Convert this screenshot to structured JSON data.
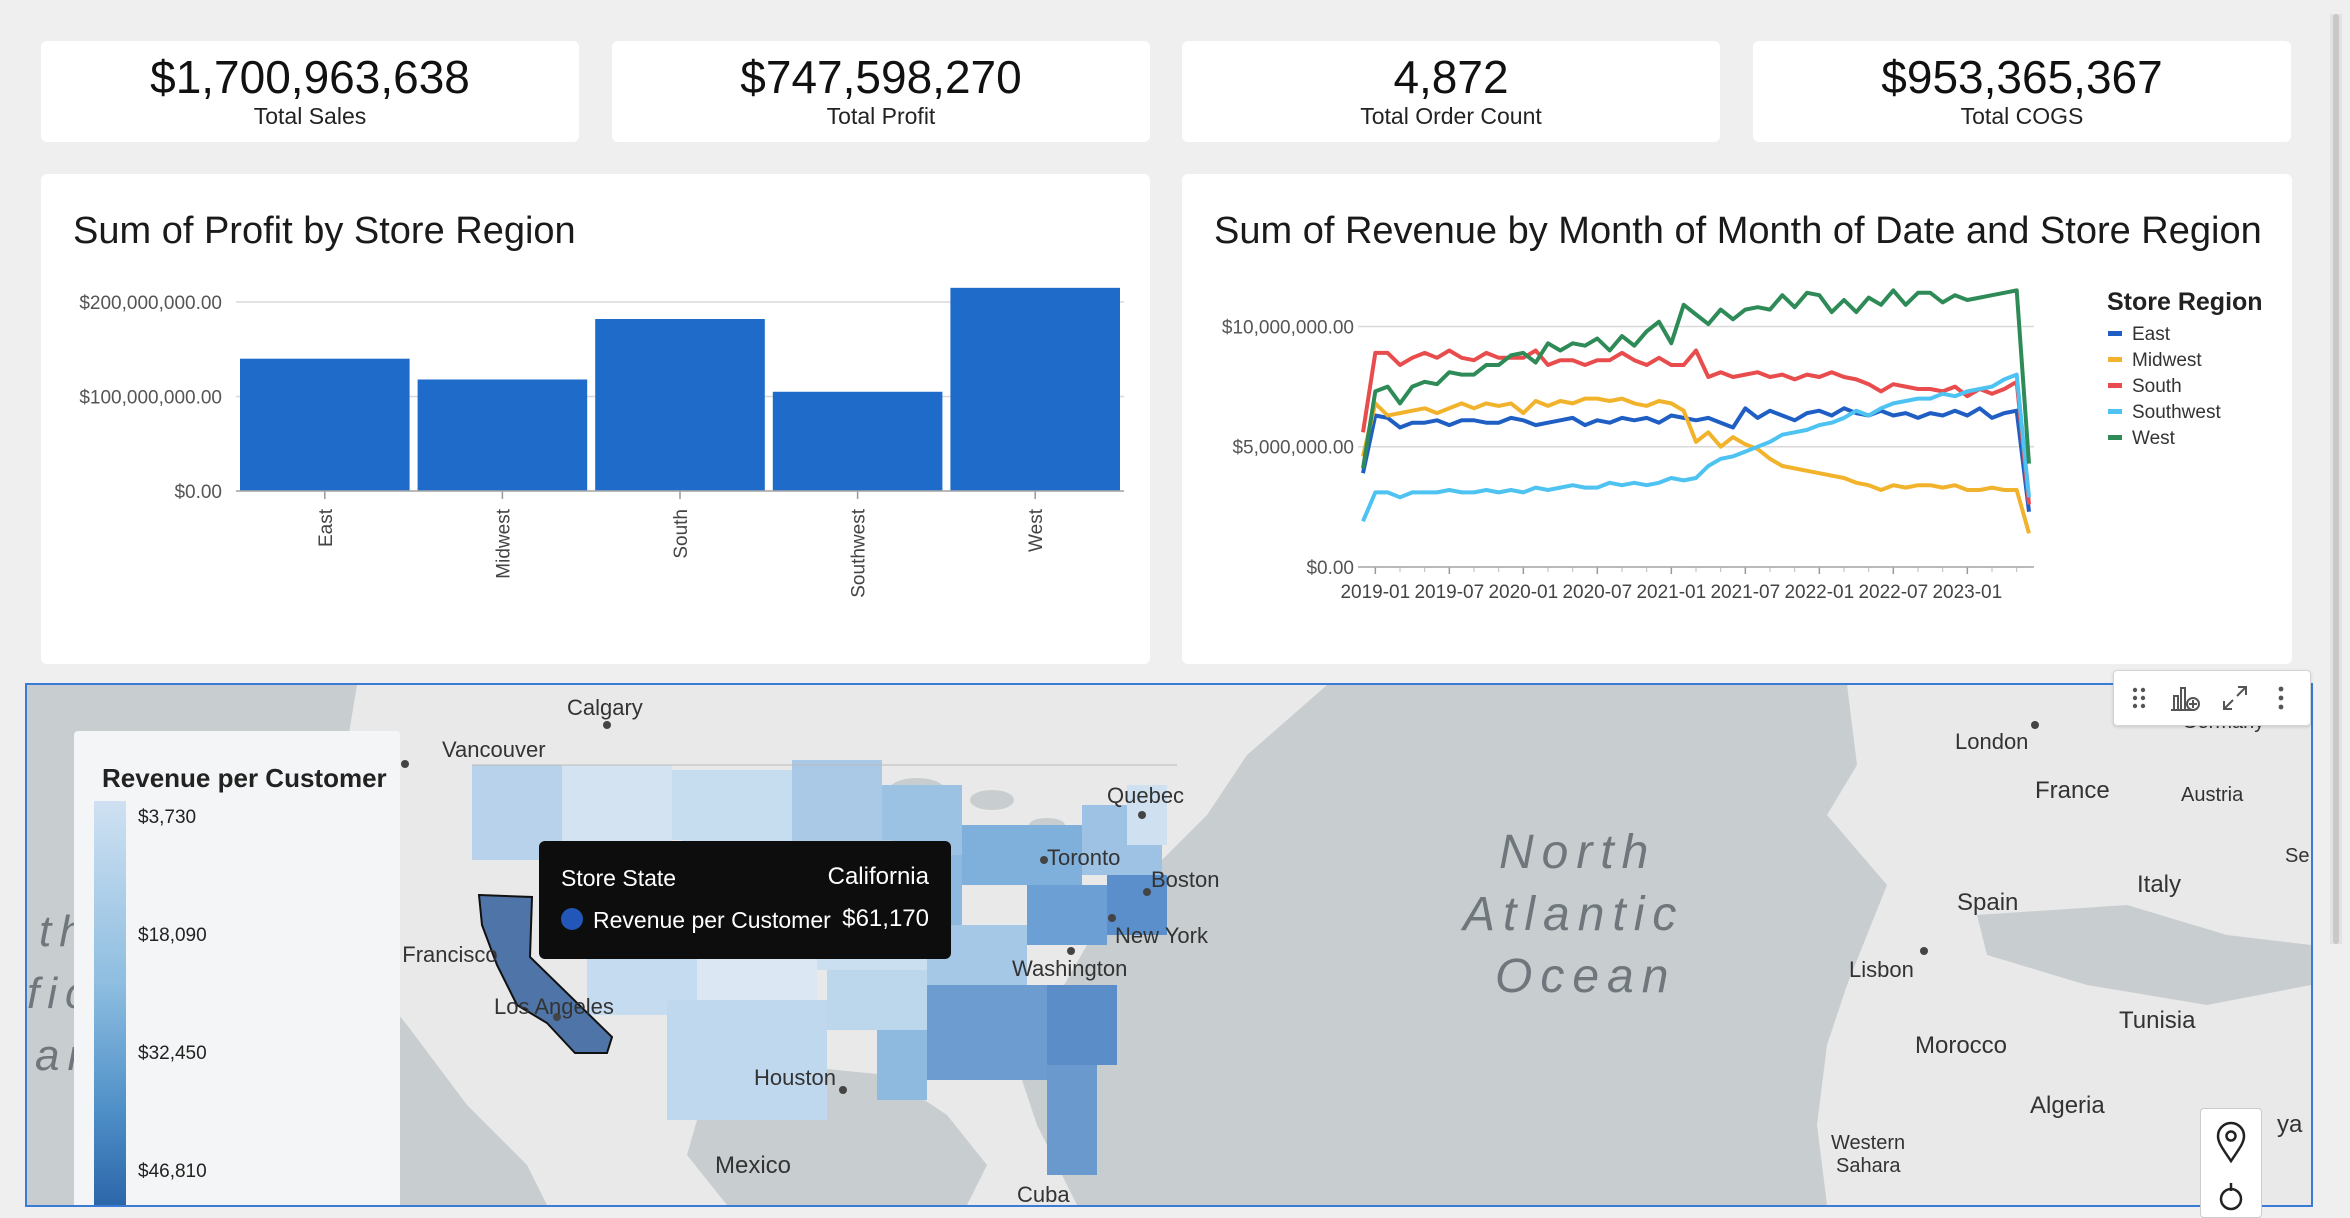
{
  "kpis": [
    {
      "value": "$1,700,963,638",
      "label": "Total Sales"
    },
    {
      "value": "$747,598,270",
      "label": "Total Profit"
    },
    {
      "value": "4,872",
      "label": "Total Order Count"
    },
    {
      "value": "$953,365,367",
      "label": "Total COGS"
    }
  ],
  "bar_card": {
    "title": "Sum of Profit by Store Region"
  },
  "line_card": {
    "title": "Sum of Revenue by Month of Month of Date and Store Region"
  },
  "chart_data": [
    {
      "type": "bar",
      "title": "Sum of Profit by Store Region",
      "categories": [
        "East",
        "Midwest",
        "South",
        "Southwest",
        "West"
      ],
      "values": [
        140000000,
        118000000,
        182000000,
        105000000,
        215000000
      ],
      "yticks": [
        "$0.00",
        "$100,000,000.00",
        "$200,000,000.00"
      ],
      "ylim": [
        0,
        215000000
      ],
      "color": "#1f6bc9",
      "grid": true
    },
    {
      "type": "line",
      "title": "Sum of Revenue by Month of Month of Date and Store Region",
      "legend_title": "Store Region",
      "legend_position": "right",
      "x_start": "2018-12",
      "xticks": [
        "2019-01",
        "2019-07",
        "2020-01",
        "2020-07",
        "2021-01",
        "2021-07",
        "2022-01",
        "2022-07",
        "2023-01"
      ],
      "yticks": [
        "$0.00",
        "$5,000,000.00",
        "$10,000,000.00"
      ],
      "ylim": [
        0,
        11600000
      ],
      "series": [
        {
          "name": "East",
          "color": "#1f5fc4",
          "values": [
            3.9,
            6.3,
            6.2,
            5.8,
            6.0,
            6.0,
            6.1,
            5.9,
            6.1,
            6.1,
            6.0,
            6.0,
            6.2,
            6.1,
            5.9,
            6.0,
            6.1,
            6.2,
            5.9,
            6.1,
            6.0,
            6.2,
            6.1,
            6.2,
            6.0,
            6.3,
            6.2,
            6.1,
            6.2,
            6.0,
            5.8,
            6.6,
            6.2,
            6.5,
            6.3,
            6.1,
            6.4,
            6.5,
            6.3,
            6.6,
            6.4,
            6.3,
            6.5,
            6.3,
            6.4,
            6.2,
            6.4,
            6.3,
            6.5,
            6.3,
            6.6,
            6.2,
            6.4,
            6.5,
            2.3
          ]
        },
        {
          "name": "Midwest",
          "color": "#f2b32c",
          "values": [
            4.6,
            6.8,
            6.3,
            6.4,
            6.5,
            6.6,
            6.4,
            6.6,
            6.8,
            6.6,
            6.8,
            6.7,
            6.8,
            6.4,
            6.9,
            6.7,
            6.9,
            6.8,
            7.0,
            7.0,
            6.9,
            7.0,
            6.8,
            6.7,
            6.9,
            6.8,
            6.5,
            5.2,
            5.6,
            5.0,
            5.4,
            5.1,
            4.9,
            4.5,
            4.2,
            4.1,
            4.0,
            3.9,
            3.8,
            3.7,
            3.5,
            3.4,
            3.2,
            3.4,
            3.3,
            3.4,
            3.4,
            3.3,
            3.4,
            3.2,
            3.2,
            3.3,
            3.2,
            3.2,
            1.4
          ]
        },
        {
          "name": "South",
          "color": "#e84c4c",
          "values": [
            5.6,
            8.9,
            8.9,
            8.4,
            8.7,
            8.9,
            8.7,
            9.0,
            8.7,
            8.6,
            8.9,
            8.7,
            8.7,
            8.7,
            9.0,
            8.4,
            8.6,
            8.6,
            8.4,
            8.6,
            8.6,
            8.9,
            8.6,
            8.4,
            8.7,
            8.4,
            8.4,
            9.0,
            7.9,
            8.1,
            7.9,
            8.0,
            8.1,
            7.9,
            8.0,
            7.8,
            8.0,
            7.9,
            8.1,
            7.9,
            7.8,
            7.6,
            7.3,
            7.6,
            7.5,
            7.4,
            7.4,
            7.3,
            7.5,
            7.1,
            7.4,
            7.2,
            7.4,
            7.7,
            2.6
          ]
        },
        {
          "name": "Southwest",
          "color": "#4ec3f2",
          "values": [
            1.9,
            3.1,
            3.1,
            2.9,
            3.1,
            3.1,
            3.1,
            3.2,
            3.1,
            3.1,
            3.2,
            3.1,
            3.2,
            3.1,
            3.3,
            3.2,
            3.3,
            3.4,
            3.3,
            3.3,
            3.5,
            3.4,
            3.5,
            3.4,
            3.5,
            3.7,
            3.6,
            3.7,
            4.2,
            4.5,
            4.6,
            4.8,
            5.0,
            5.2,
            5.5,
            5.6,
            5.7,
            5.9,
            6.0,
            6.2,
            6.5,
            6.3,
            6.6,
            6.8,
            6.9,
            7.0,
            7.0,
            7.2,
            7.1,
            7.3,
            7.4,
            7.5,
            7.8,
            8.0,
            2.9
          ]
        },
        {
          "name": "West",
          "color": "#2e8b57",
          "values": [
            4.1,
            7.3,
            7.5,
            6.8,
            7.5,
            7.7,
            7.6,
            8.1,
            8.0,
            8.0,
            8.4,
            8.4,
            8.8,
            8.9,
            8.5,
            9.3,
            9.0,
            9.3,
            9.2,
            9.5,
            9.0,
            9.6,
            9.2,
            9.8,
            10.2,
            9.3,
            10.9,
            10.5,
            10.1,
            10.7,
            10.3,
            10.7,
            10.8,
            10.7,
            11.3,
            10.8,
            11.4,
            11.3,
            10.6,
            11.1,
            10.6,
            11.2,
            10.9,
            11.5,
            10.9,
            11.4,
            11.4,
            11.0,
            11.3,
            11.1,
            11.2,
            11.3,
            11.4,
            11.5,
            4.3
          ]
        }
      ]
    }
  ],
  "map": {
    "legend_title": "Revenue per Customer",
    "legend_values": [
      "$3,730",
      "$18,090",
      "$32,450",
      "$46,810"
    ],
    "tooltip": {
      "field_label": "Store State",
      "field_value": "California",
      "measure_label": "Revenue per Customer",
      "measure_value": "$61,170"
    },
    "labels": [
      "Calgary",
      "Vancouver",
      "Quebec",
      "Toronto",
      "Boston",
      "New York",
      "Washington",
      "San Francisco",
      "Los Angeles",
      "Houston",
      "Mexico",
      "Cuba",
      "North",
      "Atlantic",
      "Ocean",
      "London",
      "France",
      "Austria",
      "Spain",
      "Italy",
      "Lisbon",
      "Morocco",
      "Tunisia",
      "Algeria",
      "Western",
      "Sahara",
      "Germany",
      "Se",
      "ya",
      "th",
      "fic",
      "an"
    ]
  },
  "toolbar": {
    "icons": [
      "drag-handle-icon",
      "add-chart-icon",
      "expand-icon",
      "more-options-icon"
    ]
  }
}
